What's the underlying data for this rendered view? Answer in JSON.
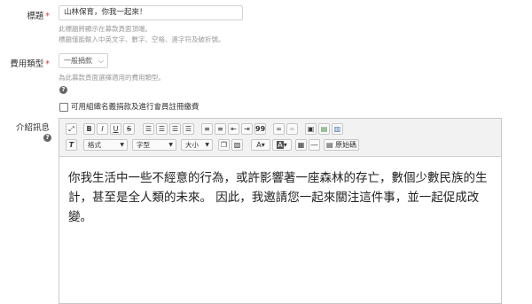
{
  "title_field": {
    "label": "標題",
    "required_mark": "*",
    "value": "山林保育，你我一起來！",
    "hints": [
      "此標題將顯示在募款頁面頂端。",
      "標題僅能輸入中英文字、數字、空格、連字符及破折號。"
    ]
  },
  "fee_type_field": {
    "label": "費用類型",
    "required_mark": "*",
    "selected": "一般捐款",
    "hint": "為此募款頁面選擇適用的費用類型。",
    "help_icon": "question-circle-icon"
  },
  "checkbox": {
    "label": "可用組織名義捐款及進行會員註冊繳費",
    "checked": false
  },
  "description_field": {
    "label": "介紹訊息",
    "help_icon": "question-circle-icon"
  },
  "toolbar": {
    "format_label": "格式",
    "font_label": "字型",
    "size_label": "大小",
    "source_label": "原始碼",
    "bold": "B",
    "italic": "I",
    "underline": "U",
    "strike": "S",
    "quote": "99"
  },
  "content": {
    "text": "你我生活中一些不經意的行為，或許影響著一座森林的存亡，數個少數民族的生計，甚至是全人類的未來。 因此，我邀請您一起來關注這件事，並一起促成改變。"
  },
  "colors": {
    "required": "#e03030",
    "toolbar_bg": "#f2f2f2",
    "border": "#c8c8c8"
  }
}
